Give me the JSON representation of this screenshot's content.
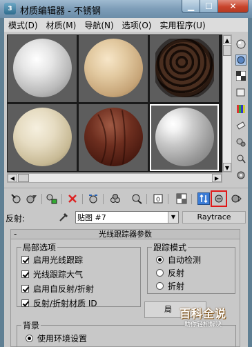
{
  "window": {
    "title": "材质编辑器 - 不锈钢",
    "app_icon": "3ds-max-icon"
  },
  "menubar": {
    "items": [
      {
        "label": "模式(D)"
      },
      {
        "label": "材质(M)"
      },
      {
        "label": "导航(N)"
      },
      {
        "label": "选项(O)"
      },
      {
        "label": "实用程序(U)"
      }
    ]
  },
  "sample_slots": [
    {
      "material": "white-matte"
    },
    {
      "material": "light-wood"
    },
    {
      "material": "dark-pattern"
    },
    {
      "material": "cream-stone"
    },
    {
      "material": "dark-wood"
    },
    {
      "material": "stainless-steel",
      "selected": true
    }
  ],
  "right_toolbar": [
    "sample-type-icon",
    "backlight-icon",
    "background-checker-icon",
    "sample-uv-icon",
    "video-color-check-icon",
    "make-preview-icon",
    "options-icon",
    "select-by-material-icon",
    "material-navigator-icon"
  ],
  "bottom_toolbar": [
    "get-material-icon",
    "put-to-scene-icon",
    "assign-to-selection-icon",
    "reset-map-icon",
    "make-copy-icon",
    "make-unique-icon",
    "put-to-library-icon",
    "material-effects-channel-icon",
    "show-in-viewport-icon",
    "show-end-result-icon",
    "go-to-parent-icon",
    "go-forward-sibling-icon"
  ],
  "reflect": {
    "label": "反射:",
    "map_value": "贴图 #7",
    "type_button": "Raytrace"
  },
  "rollout": {
    "title": "光线跟踪器参数",
    "local_options": {
      "title": "局部选项",
      "items": [
        {
          "label": "启用光线跟踪",
          "checked": true
        },
        {
          "label": "光线跟踪大气",
          "checked": true
        },
        {
          "label": "启用自反射/折射",
          "checked": true
        },
        {
          "label": "反射/折射材质 ID",
          "checked": true
        }
      ]
    },
    "trace_mode": {
      "title": "跟踪模式",
      "items": [
        {
          "label": "自动检测",
          "selected": true
        },
        {
          "label": "反射",
          "selected": false
        },
        {
          "label": "折射",
          "selected": false
        }
      ]
    },
    "partial_button": "局",
    "background": {
      "title": "背景",
      "option": "使用环境设置",
      "selected": true
    }
  },
  "watermark": {
    "title": "百科全说",
    "subtitle": "助你轻松解决"
  }
}
